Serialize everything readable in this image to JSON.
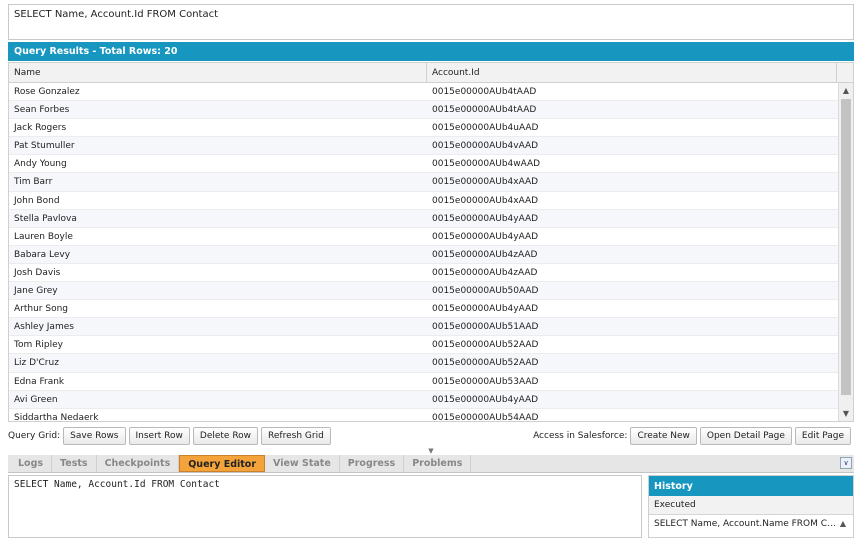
{
  "query_text": "SELECT Name, Account.Id FROM Contact",
  "results": {
    "title": "Query Results - Total Rows: 20",
    "columns": [
      "Name",
      "Account.Id"
    ],
    "rows": [
      [
        "Rose Gonzalez",
        "0015e00000AUb4tAAD"
      ],
      [
        "Sean Forbes",
        "0015e00000AUb4tAAD"
      ],
      [
        "Jack Rogers",
        "0015e00000AUb4uAAD"
      ],
      [
        "Pat Stumuller",
        "0015e00000AUb4vAAD"
      ],
      [
        "Andy Young",
        "0015e00000AUb4wAAD"
      ],
      [
        "Tim Barr",
        "0015e00000AUb4xAAD"
      ],
      [
        "John Bond",
        "0015e00000AUb4xAAD"
      ],
      [
        "Stella Pavlova",
        "0015e00000AUb4yAAD"
      ],
      [
        "Lauren Boyle",
        "0015e00000AUb4yAAD"
      ],
      [
        "Babara Levy",
        "0015e00000AUb4zAAD"
      ],
      [
        "Josh Davis",
        "0015e00000AUb4zAAD"
      ],
      [
        "Jane Grey",
        "0015e00000AUb50AAD"
      ],
      [
        "Arthur Song",
        "0015e00000AUb4yAAD"
      ],
      [
        "Ashley James",
        "0015e00000AUb51AAD"
      ],
      [
        "Tom Ripley",
        "0015e00000AUb52AAD"
      ],
      [
        "Liz D'Cruz",
        "0015e00000AUb52AAD"
      ],
      [
        "Edna Frank",
        "0015e00000AUb53AAD"
      ],
      [
        "Avi Green",
        "0015e00000AUb4yAAD"
      ],
      [
        "Siddartha Nedaerk",
        "0015e00000AUb54AAD"
      ]
    ]
  },
  "toolbar": {
    "grid_label": "Query Grid:",
    "save_rows": "Save Rows",
    "insert_row": "Insert Row",
    "delete_row": "Delete Row",
    "refresh_grid": "Refresh Grid",
    "access_label": "Access in Salesforce:",
    "create_new": "Create New",
    "open_detail": "Open Detail Page",
    "edit_page": "Edit Page"
  },
  "tabs": [
    {
      "label": "Logs",
      "active": false
    },
    {
      "label": "Tests",
      "active": false
    },
    {
      "label": "Checkpoints",
      "active": false
    },
    {
      "label": "Query Editor",
      "active": true
    },
    {
      "label": "View State",
      "active": false
    },
    {
      "label": "Progress",
      "active": false
    },
    {
      "label": "Problems",
      "active": false
    }
  ],
  "editor_text": "SELECT Name, Account.Id FROM Contact",
  "history": {
    "title": "History",
    "column": "Executed",
    "items": [
      "SELECT Name, Account.Name FROM Contact"
    ]
  },
  "colors": {
    "header_blue": "#1797c0",
    "active_tab": "#f3a33a"
  }
}
